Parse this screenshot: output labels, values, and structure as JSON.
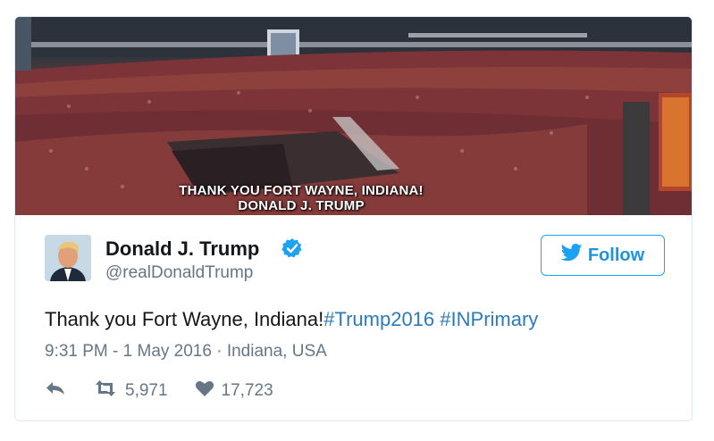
{
  "photo": {
    "caption_line1": "THANK YOU FORT WAYNE, INDIANA!",
    "caption_line2": "DONALD J. TRUMP"
  },
  "user": {
    "name": "Donald J. Trump",
    "handle": "@realDonaldTrump",
    "verified": true
  },
  "follow_button": {
    "label": "Follow"
  },
  "tweet": {
    "text": "Thank you Fort Wayne, Indiana!",
    "hashtags": [
      "#Trump2016",
      "#INPrimary"
    ],
    "timestamp": "9:31 PM - 1 May 2016",
    "separator": "·",
    "location": "Indiana, USA"
  },
  "stats": {
    "retweets": "5,971",
    "likes": "17,723"
  },
  "colors": {
    "accent": "#1da1f2",
    "link": "#2b7bb9",
    "muted": "#657786",
    "text": "#14171a"
  },
  "icons": [
    "verified-badge-icon",
    "twitter-bird-icon",
    "reply-icon",
    "retweet-icon",
    "heart-icon"
  ]
}
